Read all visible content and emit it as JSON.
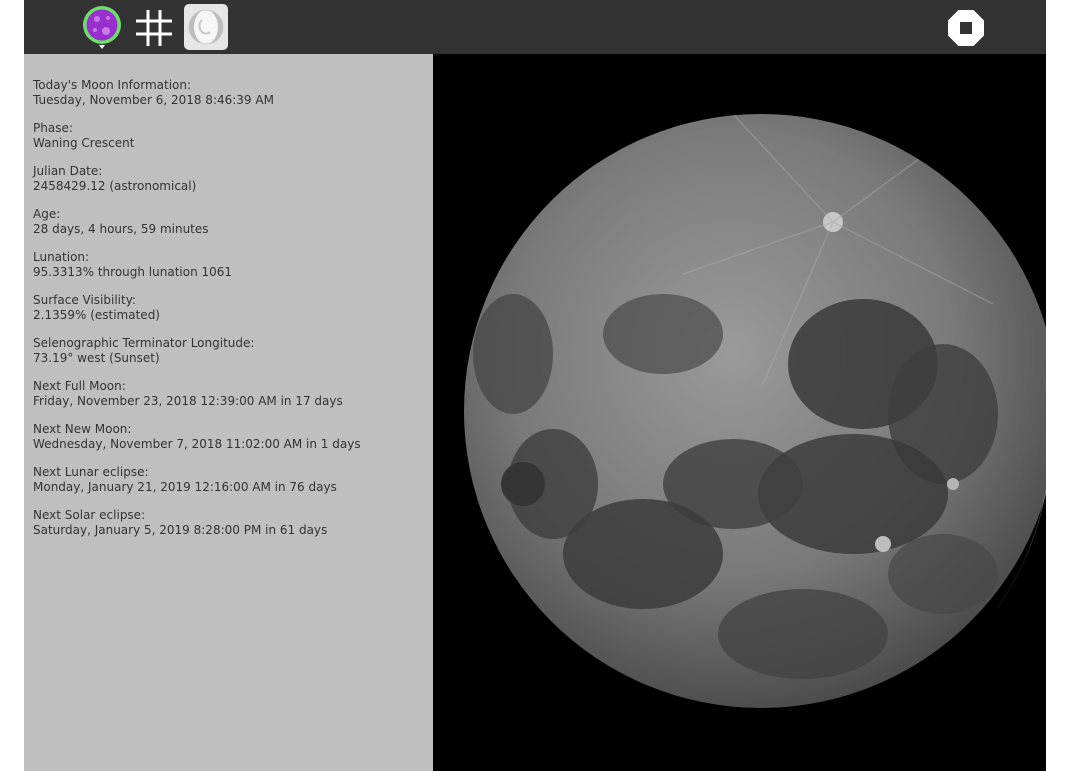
{
  "toolbar": {
    "icons": {
      "moon_view": "moon-view-icon",
      "grid": "grid-icon",
      "phase": "moon-phase-icon",
      "stop": "stop-icon"
    },
    "accent_colors": {
      "moon_view_fill": "#9a2fd0",
      "moon_view_ring": "#6be06b",
      "toolbar_bg": "#333333"
    }
  },
  "info": {
    "title": {
      "label": "Today's Moon Information:",
      "value": "Tuesday, November 6, 2018 8:46:39 AM"
    },
    "phase": {
      "label": "Phase:",
      "value": "Waning Crescent"
    },
    "julian_date": {
      "label": "Julian Date:",
      "value": "2458429.12 (astronomical)"
    },
    "age": {
      "label": "Age:",
      "value": "28 days, 4 hours, 59 minutes"
    },
    "lunation": {
      "label": "Lunation:",
      "value": "95.3313% through lunation 1061"
    },
    "surface_visibility": {
      "label": "Surface Visibility:",
      "value": "2.1359% (estimated)"
    },
    "terminator": {
      "label": "Selenographic Terminator Longitude:",
      "value": "73.19° west (Sunset)"
    },
    "next_full_moon": {
      "label": "Next Full Moon:",
      "value": "Friday, November 23, 2018 12:39:00 AM in 17 days"
    },
    "next_new_moon": {
      "label": "Next New Moon:",
      "value": "Wednesday, November 7, 2018 11:02:00 AM in 1 days"
    },
    "next_lunar_eclipse": {
      "label": "Next Lunar eclipse:",
      "value": "Monday, January 21, 2019 12:16:00 AM in 76 days"
    },
    "next_solar_eclipse": {
      "label": "Next Solar eclipse:",
      "value": "Saturday, January 5, 2019 8:28:00 PM in 61 days"
    }
  },
  "moon_image": {
    "icon": "moon-surface-image"
  }
}
